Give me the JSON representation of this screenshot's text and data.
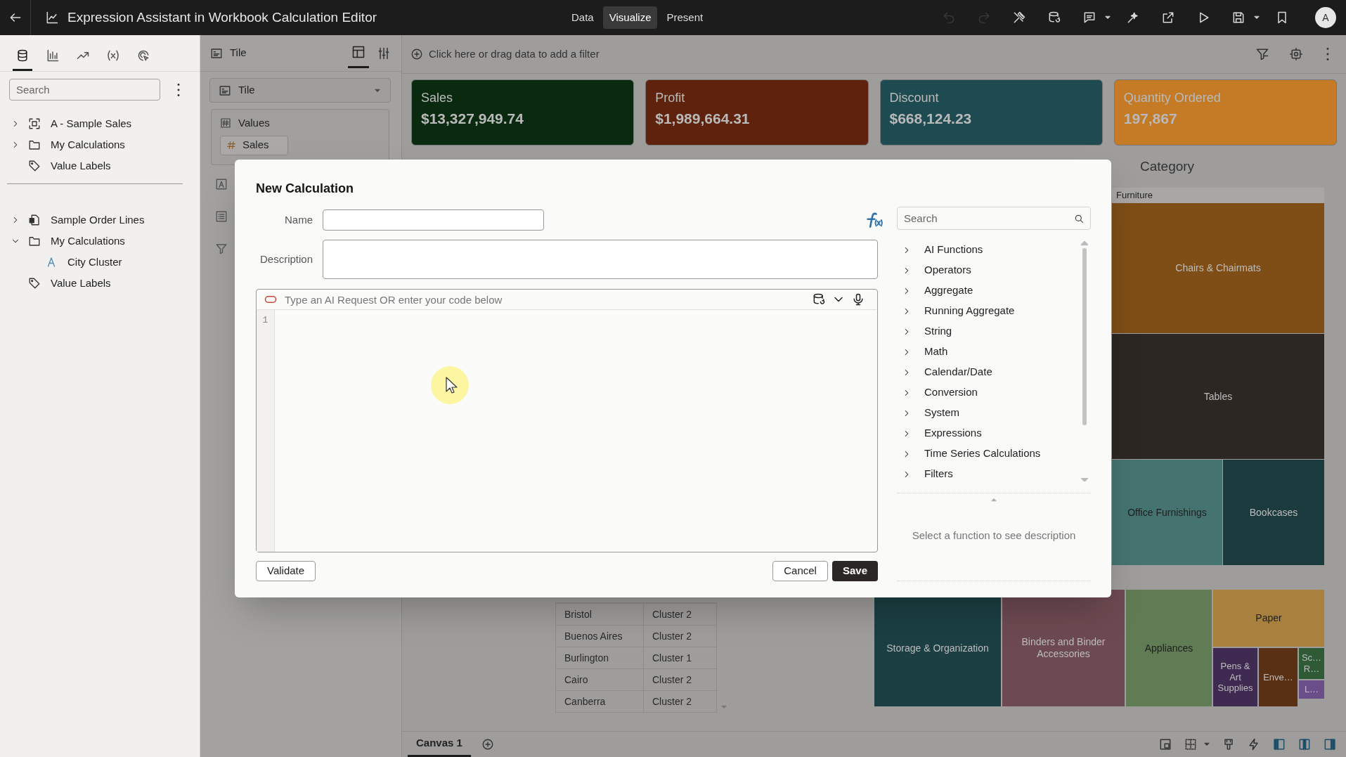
{
  "app_bar": {
    "title": "Expression Assistant in Workbook Calculation Editor",
    "modes": [
      {
        "label": "Data",
        "selected": false
      },
      {
        "label": "Visualize",
        "selected": true
      },
      {
        "label": "Present",
        "selected": false
      }
    ],
    "actions": [
      {
        "kind": "undo",
        "disabled": true
      },
      {
        "kind": "redo",
        "disabled": true
      },
      {
        "kind": "tools",
        "disabled": false
      },
      {
        "kind": "data-refresh",
        "disabled": false
      },
      {
        "kind": "comment",
        "disabled": false
      },
      {
        "kind": "caret",
        "disabled": false
      },
      {
        "kind": "sparkle",
        "disabled": false
      },
      {
        "kind": "export",
        "disabled": false
      },
      {
        "kind": "play",
        "disabled": false
      },
      {
        "kind": "save",
        "disabled": false
      },
      {
        "kind": "caret",
        "disabled": false
      },
      {
        "kind": "bookmark",
        "disabled": false
      }
    ],
    "avatar": "A"
  },
  "data_panel": {
    "tabs": [
      {
        "kind": "data",
        "selected": true
      },
      {
        "kind": "chart",
        "selected": false
      },
      {
        "kind": "trend",
        "selected": false
      },
      {
        "kind": "variable",
        "selected": false
      },
      {
        "kind": "explain",
        "selected": false
      }
    ],
    "search": {
      "placeholder": "Search"
    },
    "sections": [
      [
        {
          "label": "A - Sample Sales",
          "kind": "subject",
          "expanded": false
        },
        {
          "label": "My Calculations",
          "kind": "folder",
          "expanded": false
        },
        {
          "label": "Value Labels",
          "kind": "tag"
        }
      ],
      [
        {
          "label": "Sample Order Lines",
          "kind": "dataset",
          "expanded": false
        },
        {
          "label": "My Calculations",
          "kind": "folder",
          "expanded": true,
          "children": [
            {
              "label": "City Cluster",
              "kind": "attribute"
            }
          ]
        },
        {
          "label": "Value Labels",
          "kind": "tag"
        }
      ]
    ]
  },
  "grammar_panel": {
    "title": "Tile",
    "viz_type": "Tile",
    "sections": [
      {
        "label": "Values",
        "items": [
          "Sales"
        ]
      }
    ]
  },
  "filter_bar": {
    "placeholder": "Click here or drag data to add a filter"
  },
  "tiles": [
    {
      "label": "Sales",
      "value": "$13,327,949.74",
      "color": "#0a2a10"
    },
    {
      "label": "Profit",
      "value": "$1,989,664.31",
      "color": "#5e220d"
    },
    {
      "label": "Discount",
      "value": "$668,124.23",
      "color": "#1e4a52"
    },
    {
      "label": "Quantity Ordered",
      "value": "197,867",
      "color": "#c57a25"
    }
  ],
  "table": {
    "rows": [
      [
        "Bristol",
        "Cluster 2"
      ],
      [
        "Buenos Aires",
        "Cluster 2"
      ],
      [
        "Burlington",
        "Cluster 1"
      ],
      [
        "Cairo",
        "Cluster 2"
      ],
      [
        "Canberra",
        "Cluster 2"
      ]
    ]
  },
  "treemap": {
    "title": "Category",
    "group": "Furniture",
    "cells": [
      {
        "label": "Chairs & Chairmats",
        "color": "#7f4e17"
      },
      {
        "label": "Tables",
        "color": "#2d2723"
      },
      {
        "label": "Office Furnishings",
        "color": "#457470"
      },
      {
        "label": "Bookcases",
        "color": "#1b3a3e"
      },
      {
        "label": "Storage & Organization",
        "color": "#1b3f42"
      },
      {
        "label": "Binders and Binder Accessories",
        "color": "#6d4a51"
      },
      {
        "label": "Appliances",
        "color": "#5f7c54"
      },
      {
        "label": "Paper",
        "color": "#a8813f"
      },
      {
        "label": "Pens & Art Supplies",
        "color": "#3f2a52"
      },
      {
        "label": "Enve…",
        "color": "#5a3015"
      },
      {
        "label": "Sc… R…",
        "color": "#2e5a36"
      },
      {
        "label": "L…",
        "color": "#6a4e8a"
      }
    ]
  },
  "canvas_tabs": [
    {
      "label": "Canvas 1",
      "selected": true
    }
  ],
  "dialog": {
    "title": "New Calculation",
    "fields": [
      {
        "label": "Name",
        "kind": "input"
      },
      {
        "label": "Description",
        "kind": "textarea"
      }
    ],
    "editor": {
      "placeholder": "Type an AI Request OR enter your code below",
      "line_numbers": [
        "1"
      ]
    },
    "function_search": {
      "placeholder": "Search"
    },
    "categories": [
      "AI Functions",
      "Operators",
      "Aggregate",
      "Running Aggregate",
      "String",
      "Math",
      "Calendar/Date",
      "Conversion",
      "System",
      "Expressions",
      "Time Series Calculations",
      "Filters"
    ],
    "description_hint": "Select a function to see description",
    "buttons": {
      "validate": "Validate",
      "cancel": "Cancel",
      "save": "Save"
    }
  }
}
